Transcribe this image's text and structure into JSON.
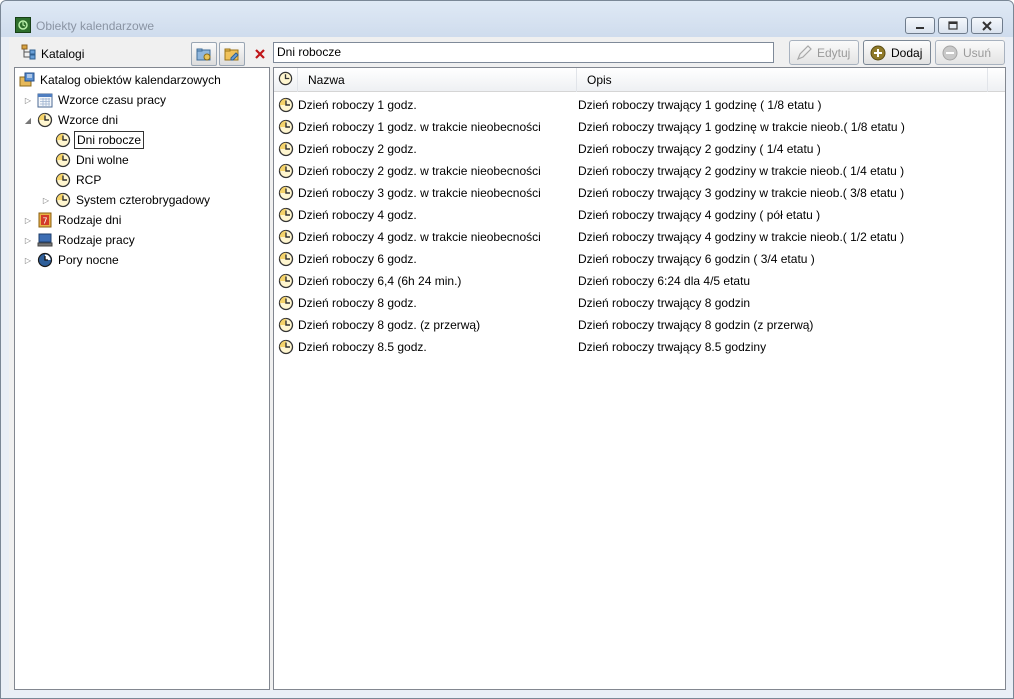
{
  "window": {
    "title": "Obiekty kalendarzowe",
    "buttons": {
      "minimize": "▭",
      "maximize": "▢",
      "close": "✕"
    }
  },
  "left": {
    "toolbar_title": "Katalogi",
    "tree": [
      {
        "label": "Katalog obiektów kalendarzowych",
        "icon": "catalog-icon",
        "level": 0,
        "arrow": ""
      },
      {
        "label": "Wzorce czasu pracy",
        "icon": "calendar-icon",
        "level": 1,
        "arrow": "▷"
      },
      {
        "label": "Wzorce dni",
        "icon": "clock-icon",
        "level": 1,
        "arrow": "◢"
      },
      {
        "label": "Dni robocze",
        "icon": "clock-icon",
        "level": 2,
        "arrow": "",
        "selected": true
      },
      {
        "label": "Dni wolne",
        "icon": "clock-icon",
        "level": 2,
        "arrow": ""
      },
      {
        "label": "RCP",
        "icon": "clock-icon",
        "level": 2,
        "arrow": ""
      },
      {
        "label": "System czterobrygadowy",
        "icon": "clock-icon",
        "level": 2,
        "arrow": "▷"
      },
      {
        "label": "Rodzaje dni",
        "icon": "day-type-icon",
        "level": 1,
        "arrow": "▷"
      },
      {
        "label": "Rodzaje pracy",
        "icon": "computer-icon",
        "level": 1,
        "arrow": "▷"
      },
      {
        "label": "Pory nocne",
        "icon": "night-clock-icon",
        "level": 1,
        "arrow": "▷"
      }
    ]
  },
  "right": {
    "path": "Dni robocze",
    "buttons": {
      "edit": "Edytuj",
      "add": "Dodaj",
      "delete": "Usuń"
    },
    "columns": {
      "name": "Nazwa",
      "desc": "Opis"
    },
    "rows": [
      {
        "name": "Dzień roboczy 1 godz.",
        "desc": "Dzień roboczy trwający 1 godzinę ( 1/8 etatu )"
      },
      {
        "name": "Dzień roboczy 1 godz. w trakcie nieobecności",
        "desc": "Dzień roboczy trwający 1 godzinę w trakcie nieob.( 1/8 etatu )"
      },
      {
        "name": "Dzień roboczy 2 godz.",
        "desc": "Dzień roboczy trwający 2 godziny ( 1/4 etatu )"
      },
      {
        "name": "Dzień roboczy 2 godz. w trakcie nieobecności",
        "desc": "Dzień roboczy trwający 2 godziny w trakcie nieob.( 1/4 etatu )"
      },
      {
        "name": "Dzień roboczy 3 godz. w trakcie nieobecności",
        "desc": "Dzień roboczy trwający 3 godziny w trakcie nieob.( 3/8 etatu )"
      },
      {
        "name": "Dzień roboczy 4 godz.",
        "desc": "Dzień roboczy trwający 4 godziny ( pół etatu )"
      },
      {
        "name": "Dzień roboczy 4 godz. w trakcie nieobecności",
        "desc": "Dzień roboczy trwający 4 godziny w trakcie nieob.( 1/2 etatu )"
      },
      {
        "name": "Dzień roboczy 6 godz.",
        "desc": "Dzień roboczy trwający 6 godzin ( 3/4 etatu )"
      },
      {
        "name": "Dzień roboczy 6,4 (6h 24 min.)",
        "desc": "Dzień roboczy 6:24 dla 4/5 etatu"
      },
      {
        "name": "Dzień roboczy 8 godz.",
        "desc": "Dzień roboczy trwający 8 godzin"
      },
      {
        "name": "Dzień roboczy 8 godz. (z przerwą)",
        "desc": "Dzień roboczy trwający 8 godzin (z przerwą)"
      },
      {
        "name": "Dzień roboczy 8.5 godz.",
        "desc": "Dzień roboczy trwający 8.5 godziny"
      }
    ]
  }
}
